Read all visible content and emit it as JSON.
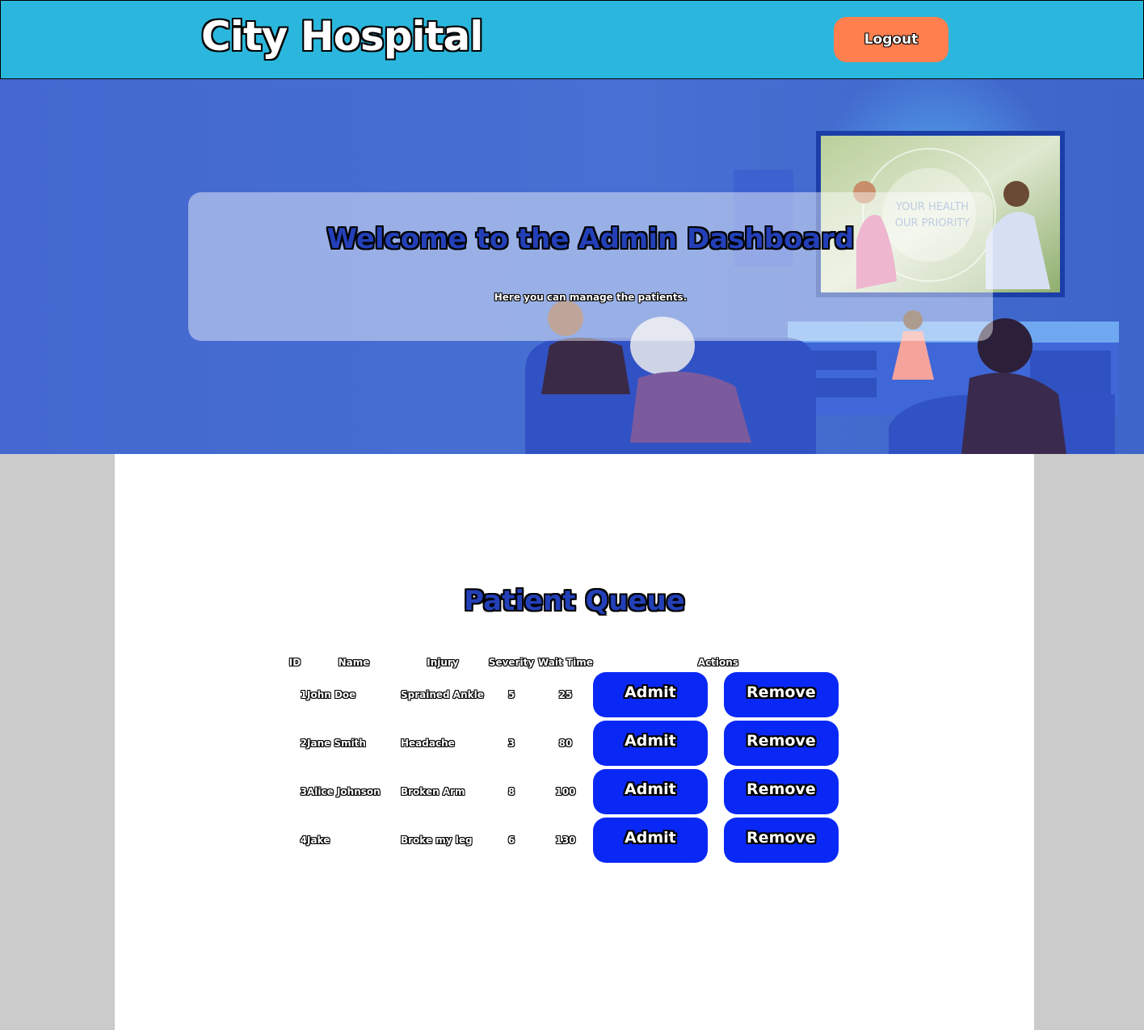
{
  "header": {
    "brand": "City Hospital",
    "logout_label": "Logout"
  },
  "hero": {
    "title": "Welcome to the Admin Dashboard",
    "subtitle": "Here you can manage the patients.",
    "tv_text_line1": "YOUR HEALTH",
    "tv_text_line2": "OUR PRIORITY"
  },
  "queue": {
    "title": "Patient Queue",
    "columns": {
      "id": "ID",
      "name": "Name",
      "injury": "Injury",
      "severity": "Severity",
      "wait": "Wait Time",
      "actions": "Actions"
    },
    "admit_label": "Admit",
    "remove_label": "Remove",
    "rows": [
      {
        "id": "1",
        "name": "John Doe",
        "injury": "Sprained Ankle",
        "severity": "5",
        "wait": "25"
      },
      {
        "id": "2",
        "name": "Jane Smith",
        "injury": "Headache",
        "severity": "3",
        "wait": "80"
      },
      {
        "id": "3",
        "name": "Alice Johnson",
        "injury": "Broken Arm",
        "severity": "8",
        "wait": "100"
      },
      {
        "id": "4",
        "name": "Jake",
        "injury": "Broke my leg",
        "severity": "6",
        "wait": "130"
      }
    ]
  },
  "colors": {
    "header_bg": "#2bb7dd",
    "logout_bg": "#ff7f4f",
    "hero_bg": "#4468cf",
    "action_button_bg": "#0a28f5",
    "title_blue": "#2340b8",
    "page_gutter": "#cbcbcb"
  }
}
